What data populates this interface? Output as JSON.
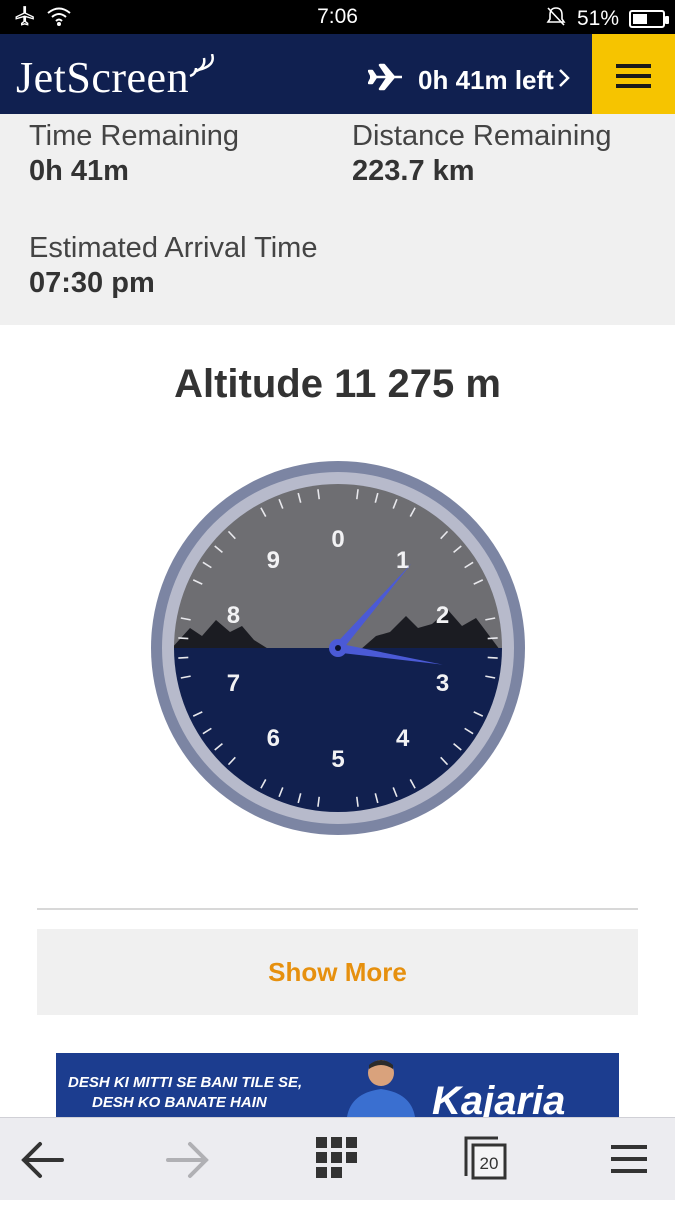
{
  "status_bar": {
    "time": "7:06",
    "battery": "51%",
    "battery_level": 0.51,
    "icons": [
      "airplane-mode-icon",
      "wifi-icon",
      "mute-icon",
      "battery-icon"
    ]
  },
  "header": {
    "logo_text": "JetScreen",
    "flight_status": "0h 41m left",
    "icons": [
      "plane-icon",
      "chevron-right-icon",
      "hamburger-menu-icon"
    ]
  },
  "info": {
    "time_remaining_label": "Time Remaining",
    "time_remaining_value": "0h 41m",
    "distance_remaining_label": "Distance Remaining",
    "distance_remaining_value": "223.7 km",
    "eta_label": "Estimated Arrival Time",
    "eta_value": "07:30 pm"
  },
  "altitude": {
    "title": "Altitude 11 275 m",
    "dial_numbers": [
      "0",
      "1",
      "2",
      "3",
      "4",
      "5",
      "6",
      "7",
      "8",
      "9"
    ]
  },
  "show_more_label": "Show More",
  "ad": {
    "tagline_line1": "DESH KI MITTI SE BANI TILE SE,",
    "tagline_line2": "DESH KO BANATE HAIN",
    "brand": "Kajaria"
  },
  "bottom_nav": {
    "tab_count": "20",
    "icons": [
      "back-arrow-icon",
      "forward-arrow-icon",
      "apps-grid-icon",
      "tabs-icon",
      "menu-icon"
    ]
  },
  "colors": {
    "header_bg": "#102050",
    "menu_accent": "#f6c400",
    "show_more_text": "#e6900e",
    "dial_sky": "#6e6e72",
    "dial_ground": "#11204f",
    "needle": "#4b5ad6"
  }
}
